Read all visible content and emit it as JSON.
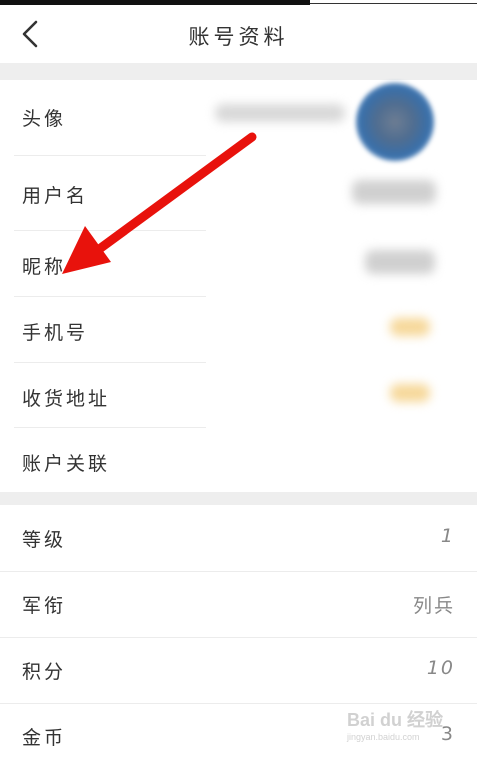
{
  "header": {
    "title": "账号资料"
  },
  "profile_items": [
    {
      "label": "头像"
    },
    {
      "label": "用户名"
    },
    {
      "label": "昵称"
    },
    {
      "label": "手机号"
    },
    {
      "label": "收货地址"
    },
    {
      "label": "账户关联"
    }
  ],
  "stats_items": [
    {
      "label": "等级",
      "value": "1"
    },
    {
      "label": "军衔",
      "value": "列兵"
    },
    {
      "label": "积分",
      "value": "10"
    },
    {
      "label": "金币",
      "value": "3"
    }
  ],
  "watermark": {
    "brand": "Bai du 经验",
    "url": "jingyan.baidu.com"
  },
  "colors": {
    "divider_gap": "#eeeeee",
    "arrow": "#e8120c",
    "text": "#333333",
    "value_text": "#888888"
  }
}
